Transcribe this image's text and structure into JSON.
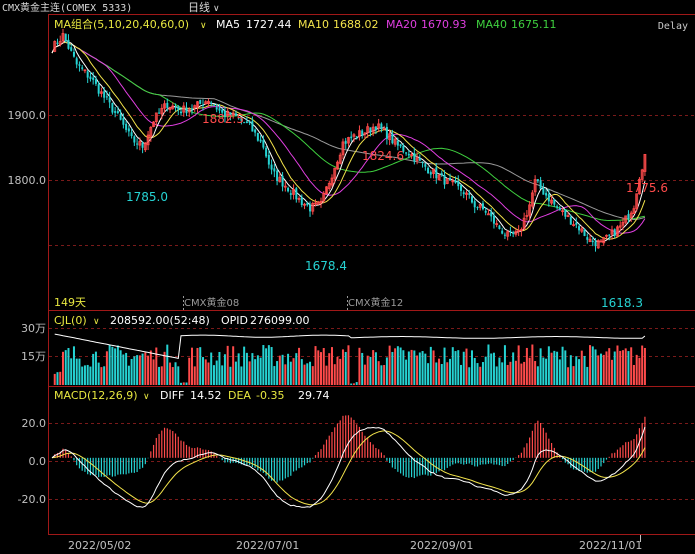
{
  "header": {
    "title": "CMX黄金主连(COMEX 5333)",
    "period": "日线",
    "status": "Delay"
  },
  "colors": {
    "bg": "#000000",
    "up": "#ff4b4b",
    "down": "#26d3d3",
    "grid": "#7a1a1a",
    "axis": "#a01818",
    "text": "#c0c0c0",
    "ma5": "#ffffff",
    "ma10": "#f2e34b",
    "ma20": "#e03fe0",
    "ma40": "#3fd03f",
    "ma60": "#9a9a9a",
    "label": "#e8e840"
  },
  "main_panel": {
    "indicator_label": "MA组合(5,10,20,40,60,0)",
    "ma": [
      {
        "name": "MA5",
        "value": "1727.44"
      },
      {
        "name": "MA10",
        "value": "1688.02"
      },
      {
        "name": "MA20",
        "value": "1670.93"
      },
      {
        "name": "MA40",
        "value": "1675.11"
      }
    ],
    "y_ticks": [
      "1900.0",
      "1800.0"
    ],
    "annotations": [
      "1882.5",
      "1785.0",
      "1824.6",
      "1678.4",
      "1775.6",
      "1618.3"
    ],
    "bar_count_label": "149天",
    "contract_labels": [
      "CMX黄金08",
      "CMX黄金12"
    ]
  },
  "volume_panel": {
    "label": "CJL(0)",
    "volume": "208592.00(52:48)",
    "opid_label": "OPID",
    "opid": "276099.00",
    "y_ticks": [
      "30万",
      "15万"
    ]
  },
  "macd_panel": {
    "label": "MACD(12,26,9)",
    "diff_label": "DIFF",
    "diff": "14.52",
    "dea_label": "DEA",
    "dea": "-0.35",
    "macd": "29.74",
    "y_ticks": [
      "20.0",
      "0.0",
      "-20.0"
    ]
  },
  "x_axis": {
    "dates": [
      "2022/05/02",
      "2022/07/01",
      "2022/09/01",
      "2022/11/01"
    ]
  },
  "chart_data": {
    "type": "candlestick",
    "x_axis_dates": [
      "2022/05/02",
      "2022/07/01",
      "2022/09/01",
      "2022/11/01"
    ],
    "bar_count": 149,
    "price_ylim": [
      1560,
      1990
    ],
    "price_annotations": {
      "high_1": 1882.5,
      "low_1": 1785.0,
      "high_2": 1824.6,
      "low_2": 1678.4,
      "last_high": 1775.6,
      "low_3": 1618.3
    },
    "ma_last": {
      "MA5": 1727.44,
      "MA10": 1688.02,
      "MA20": 1670.93,
      "MA40": 1675.11
    },
    "close_path": [
      [
        0,
        1940
      ],
      [
        4,
        1960
      ],
      [
        9,
        1915
      ],
      [
        14,
        1895
      ],
      [
        19,
        1865
      ],
      [
        24,
        1835
      ],
      [
        29,
        1800
      ],
      [
        33,
        1790
      ],
      [
        37,
        1830
      ],
      [
        42,
        1855
      ],
      [
        47,
        1845
      ],
      [
        52,
        1850
      ],
      [
        57,
        1862
      ],
      [
        62,
        1840
      ],
      [
        67,
        1835
      ],
      [
        72,
        1820
      ],
      [
        77,
        1790
      ],
      [
        80,
        1750
      ],
      [
        85,
        1730
      ],
      [
        90,
        1708
      ],
      [
        94,
        1695
      ],
      [
        98,
        1700
      ],
      [
        102,
        1748
      ],
      [
        106,
        1795
      ],
      [
        110,
        1805
      ],
      [
        114,
        1812
      ],
      [
        118,
        1822
      ],
      [
        122,
        1808
      ],
      [
        126,
        1790
      ],
      [
        130,
        1780
      ],
      [
        134,
        1765
      ],
      [
        138,
        1752
      ],
      [
        142,
        1740
      ],
      [
        146,
        1730
      ],
      [
        150,
        1720
      ],
      [
        154,
        1700
      ],
      [
        158,
        1690
      ],
      [
        162,
        1668
      ],
      [
        166,
        1652
      ],
      [
        170,
        1655
      ],
      [
        174,
        1700
      ],
      [
        176,
        1735
      ],
      [
        180,
        1715
      ],
      [
        184,
        1695
      ],
      [
        188,
        1680
      ],
      [
        192,
        1665
      ],
      [
        196,
        1645
      ],
      [
        200,
        1640
      ],
      [
        204,
        1655
      ],
      [
        208,
        1670
      ],
      [
        212,
        1700
      ],
      [
        214,
        1745
      ],
      [
        216,
        1776
      ]
    ],
    "volume_ylim": [
      0,
      400000
    ],
    "volume_ticks": [
      150000,
      300000
    ],
    "volume_last": 208592,
    "opid_last": 276099,
    "macd_ylim": [
      -35,
      32
    ],
    "macd_ticks": [
      20,
      0,
      -20
    ],
    "macd_last": {
      "DIFF": 14.52,
      "DEA": -0.35,
      "MACD": 29.74
    }
  }
}
